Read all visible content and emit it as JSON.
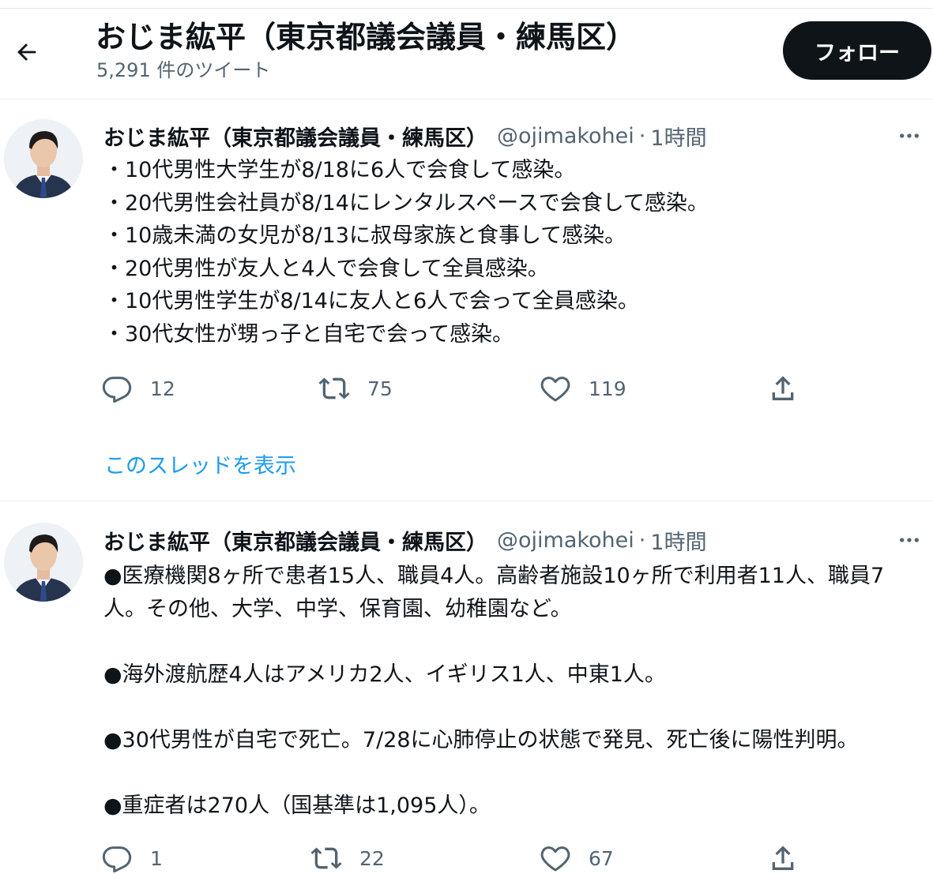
{
  "header": {
    "title": "おじま紘平（東京都議会議員・練馬区）",
    "tweet_count": "5,291 件のツイート",
    "follow_label": "フォロー"
  },
  "colors": {
    "text": "#0f1419",
    "secondary": "#536471",
    "link": "#1d9bf0",
    "follow_bg": "#0f1419"
  },
  "icons": [
    "back-arrow-icon",
    "more-icon",
    "reply-icon",
    "retweet-icon",
    "like-icon",
    "share-icon"
  ],
  "tweets": [
    {
      "author": "おじま紘平（東京都議会議員・練馬区）",
      "handle": "@ojimakohei",
      "separator": "·",
      "time": "1時間",
      "lines": [
        "・10代男性大学生が8/18に6人で会食して感染。",
        "・20代男性会社員が8/14にレンタルスペースで会食して感染。",
        "・10歳未満の女児が8/13に叔母家族と食事して感染。",
        "・20代男性が友人と4人で会食して全員感染。",
        "・10代男性学生が8/14に友人と6人で会って全員感染。",
        "・30代女性が甥っ子と自宅で会って感染。"
      ],
      "replies": "12",
      "retweets": "75",
      "likes": "119",
      "show_thread": "このスレッドを表示"
    },
    {
      "author": "おじま紘平（東京都議会議員・練馬区）",
      "handle": "@ojimakohei",
      "separator": "·",
      "time": "1時間",
      "paragraphs": [
        "●医療機関8ヶ所で患者15人、職員4人。高齢者施設10ヶ所で利用者11人、職員7人。その他、大学、中学、保育園、幼稚園など。",
        "●海外渡航歴4人はアメリカ2人、イギリス1人、中東1人。",
        "●30代男性が自宅で死亡。7/28に心肺停止の状態で発見、死亡後に陽性判明。",
        "●重症者は270人（国基準は1,095人）。"
      ],
      "replies": "1",
      "retweets": "22",
      "likes": "67"
    }
  ]
}
